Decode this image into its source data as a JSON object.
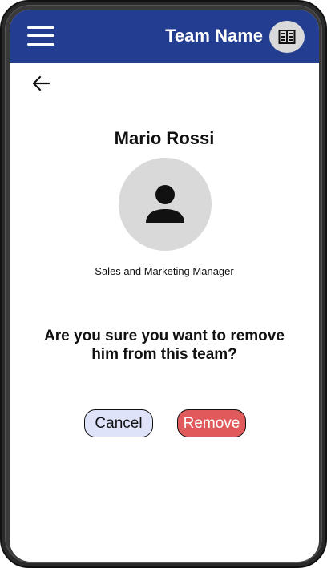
{
  "header": {
    "menu_icon": "hamburger-menu-icon",
    "team_name": "Team Name",
    "team_icon": "building-icon"
  },
  "nav": {
    "back_icon": "arrow-left-icon"
  },
  "profile": {
    "name": "Mario Rossi",
    "avatar_icon": "person-icon",
    "role": "Sales and Marketing Manager"
  },
  "dialog": {
    "question": "Are you sure you want to remove him from this team?",
    "cancel_label": "Cancel",
    "remove_label": "Remove"
  },
  "colors": {
    "header_bg": "#233d91",
    "cancel_bg": "#dfe3f9",
    "remove_bg": "#e05a5c",
    "avatar_bg": "#d9d9d9"
  }
}
